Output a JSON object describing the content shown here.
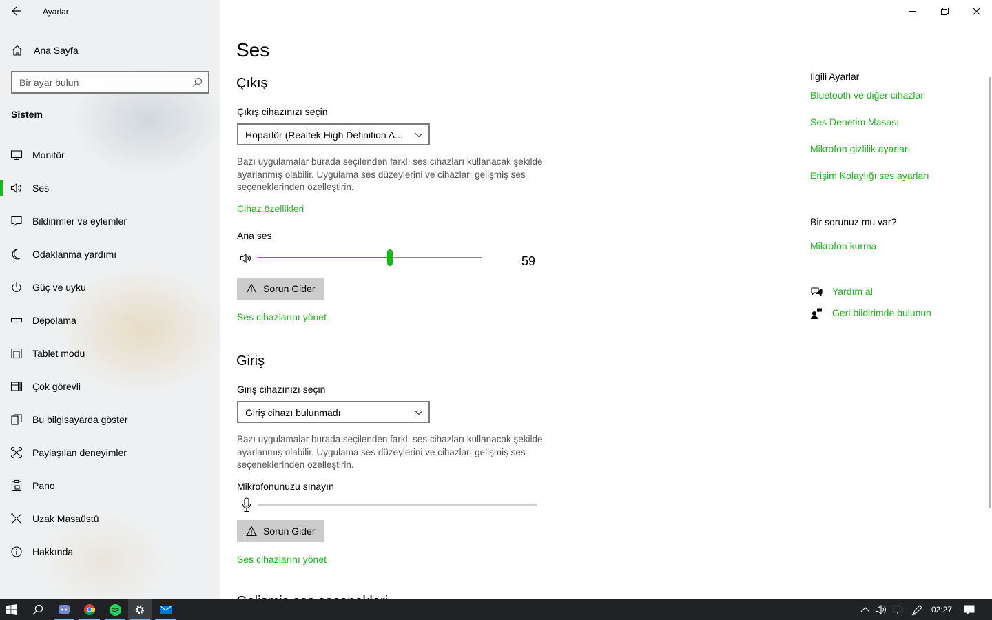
{
  "window": {
    "app_title": "Ayarlar"
  },
  "sidebar": {
    "home_label": "Ana Sayfa",
    "search_placeholder": "Bir ayar bulun",
    "section_title": "Sistem",
    "items": [
      {
        "label": "Monitör",
        "icon": "monitor-icon"
      },
      {
        "label": "Ses",
        "icon": "speaker-icon",
        "selected": true
      },
      {
        "label": "Bildirimler ve eylemler",
        "icon": "notification-icon"
      },
      {
        "label": "Odaklanma yardımı",
        "icon": "moon-icon"
      },
      {
        "label": "Güç ve uyku",
        "icon": "power-icon"
      },
      {
        "label": "Depolama",
        "icon": "storage-icon"
      },
      {
        "label": "Tablet modu",
        "icon": "tablet-icon"
      },
      {
        "label": "Çok görevli",
        "icon": "multitask-icon"
      },
      {
        "label": "Bu bilgisayarda göster",
        "icon": "project-icon"
      },
      {
        "label": "Paylaşılan deneyimler",
        "icon": "shared-icon"
      },
      {
        "label": "Pano",
        "icon": "clipboard-icon"
      },
      {
        "label": "Uzak Masaüstü",
        "icon": "remote-desktop-icon"
      },
      {
        "label": "Hakkında",
        "icon": "info-icon"
      }
    ]
  },
  "main": {
    "title": "Ses",
    "output": {
      "heading": "Çıkış",
      "select_label": "Çıkış cihazınızı seçin",
      "selected_device": "Hoparlör (Realtek High Definition A...",
      "description": "Bazı uygulamalar burada seçilenden farklı ses cihazları kullanacak şekilde ayarlanmış olabilir. Uygulama ses düzeylerini ve cihazları gelişmiş ses seçeneklerinden özelleştirin.",
      "device_properties_link": "Cihaz özellikleri",
      "master_volume_label": "Ana ses",
      "volume_value": "59",
      "volume_level": 59,
      "troubleshoot_label": "Sorun Gider",
      "manage_devices_link": "Ses cihazlarını yönet"
    },
    "input": {
      "heading": "Giriş",
      "select_label": "Giriş cihazınızı seçin",
      "selected_device": "Giriş cihazı bulunmadı",
      "description": "Bazı uygulamalar burada seçilenden farklı ses cihazları kullanacak şekilde ayarlanmış olabilir. Uygulama ses düzeylerini ve cihazları gelişmiş ses seçeneklerinden özelleştirin.",
      "test_mic_label": "Mikrofonunuzu sınayın",
      "mic_level": 0,
      "troubleshoot_label": "Sorun Gider",
      "manage_devices_link": "Ses cihazlarını yönet"
    },
    "next_heading_partial": "Gelişmiş ses seçenekleri"
  },
  "related": {
    "title": "İlgili Ayarlar",
    "links": [
      "Bluetooth ve diğer cihazlar",
      "Ses Denetim Masası",
      "Mikrofon gizlilik ayarları",
      "Erişim Kolaylığı ses ayarları"
    ],
    "question_title": "Bir sorunuz mu var?",
    "question_link": "Mikrofon kurma",
    "help_link": "Yardım al",
    "feedback_link": "Geri bildirimde bulunun"
  },
  "taskbar": {
    "clock": "02:27",
    "apps": [
      "start-icon",
      "search-icon",
      "discord-icon",
      "chrome-icon",
      "spotify-icon",
      "settings-icon",
      "mail-icon"
    ]
  },
  "colors": {
    "accent": "#17b917",
    "sidebar_bg": "#eef0f1",
    "taskbar_bg": "#202225",
    "button_bg": "#cccccc"
  }
}
